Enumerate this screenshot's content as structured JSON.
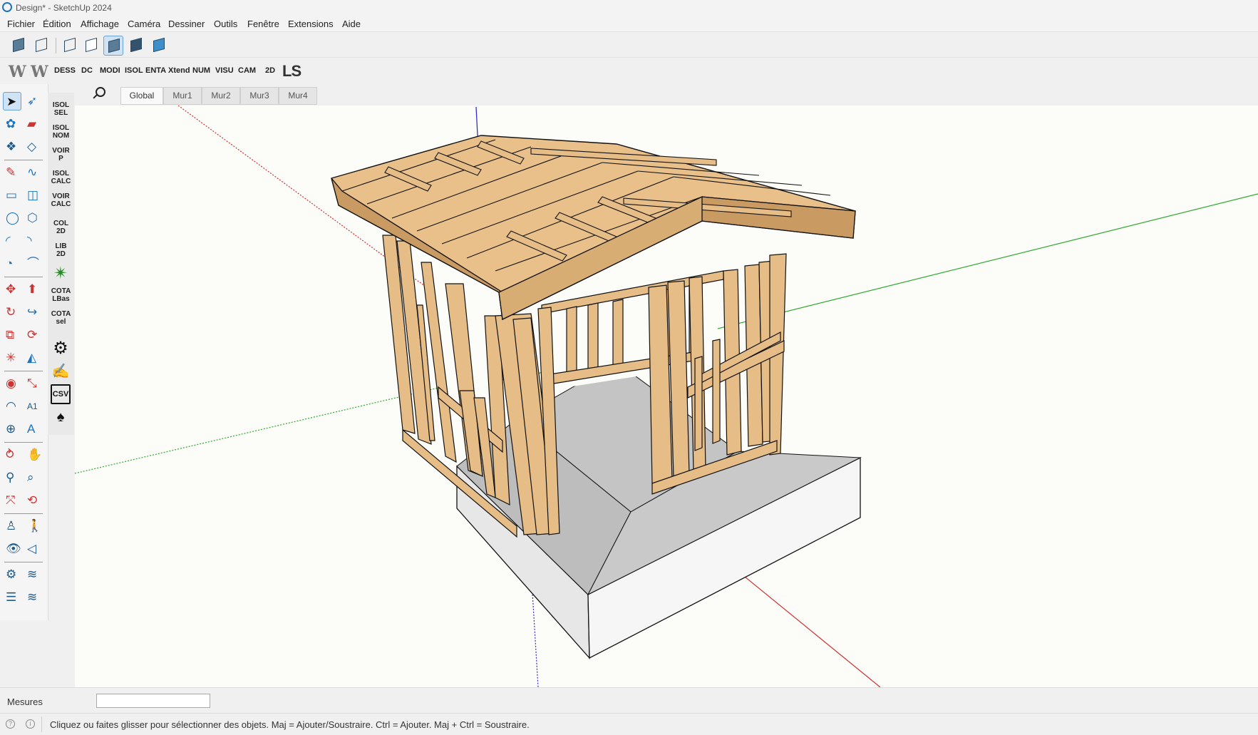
{
  "window": {
    "title": "Design* - SketchUp 2024"
  },
  "menu": [
    "Fichier",
    "Édition",
    "Affichage",
    "Caméra",
    "Dessiner",
    "Outils",
    "Fenêtre",
    "Extensions",
    "Aide"
  ],
  "toolbar2": {
    "logos": [
      "W",
      "W"
    ],
    "buttons": [
      "DESS",
      "DC",
      "MODI",
      "ISOL",
      "ENTA",
      "Xtend",
      "NUM",
      "VISU",
      "CAM",
      "2D"
    ],
    "brand": "LS"
  },
  "plugin_column": {
    "labels": [
      [
        "ISOL",
        "SEL"
      ],
      [
        "ISOL",
        "NOM"
      ],
      [
        "VOIR",
        "P"
      ],
      [
        "ISOL",
        "CALC"
      ],
      [
        "VOIR",
        "CALC"
      ],
      [
        "COL",
        "2D"
      ],
      [
        "LIB",
        "2D"
      ],
      [
        "COTA",
        "LBas"
      ],
      [
        "COTA",
        "sel"
      ]
    ],
    "csv": "CSV"
  },
  "scenes": {
    "tabs": [
      "Global",
      "Mur1",
      "Mur2",
      "Mur3",
      "Mur4"
    ],
    "active": "Global"
  },
  "measurements": {
    "label": "Mesures",
    "value": ""
  },
  "status": {
    "message": "Cliquez ou faites glisser pour sélectionner des objets. Maj = Ajouter/Soustraire. Ctrl = Ajouter. Maj + Ctrl = Soustraire."
  },
  "colors": {
    "wood": "#e6bd87",
    "wood_dark": "#c99a62",
    "floor": "#c4c4c4",
    "foundation": "#efefef",
    "axis_red": "#d03030",
    "axis_green": "#2faa2f",
    "axis_blue": "#3030c8",
    "selection": "#6aa3d6"
  }
}
